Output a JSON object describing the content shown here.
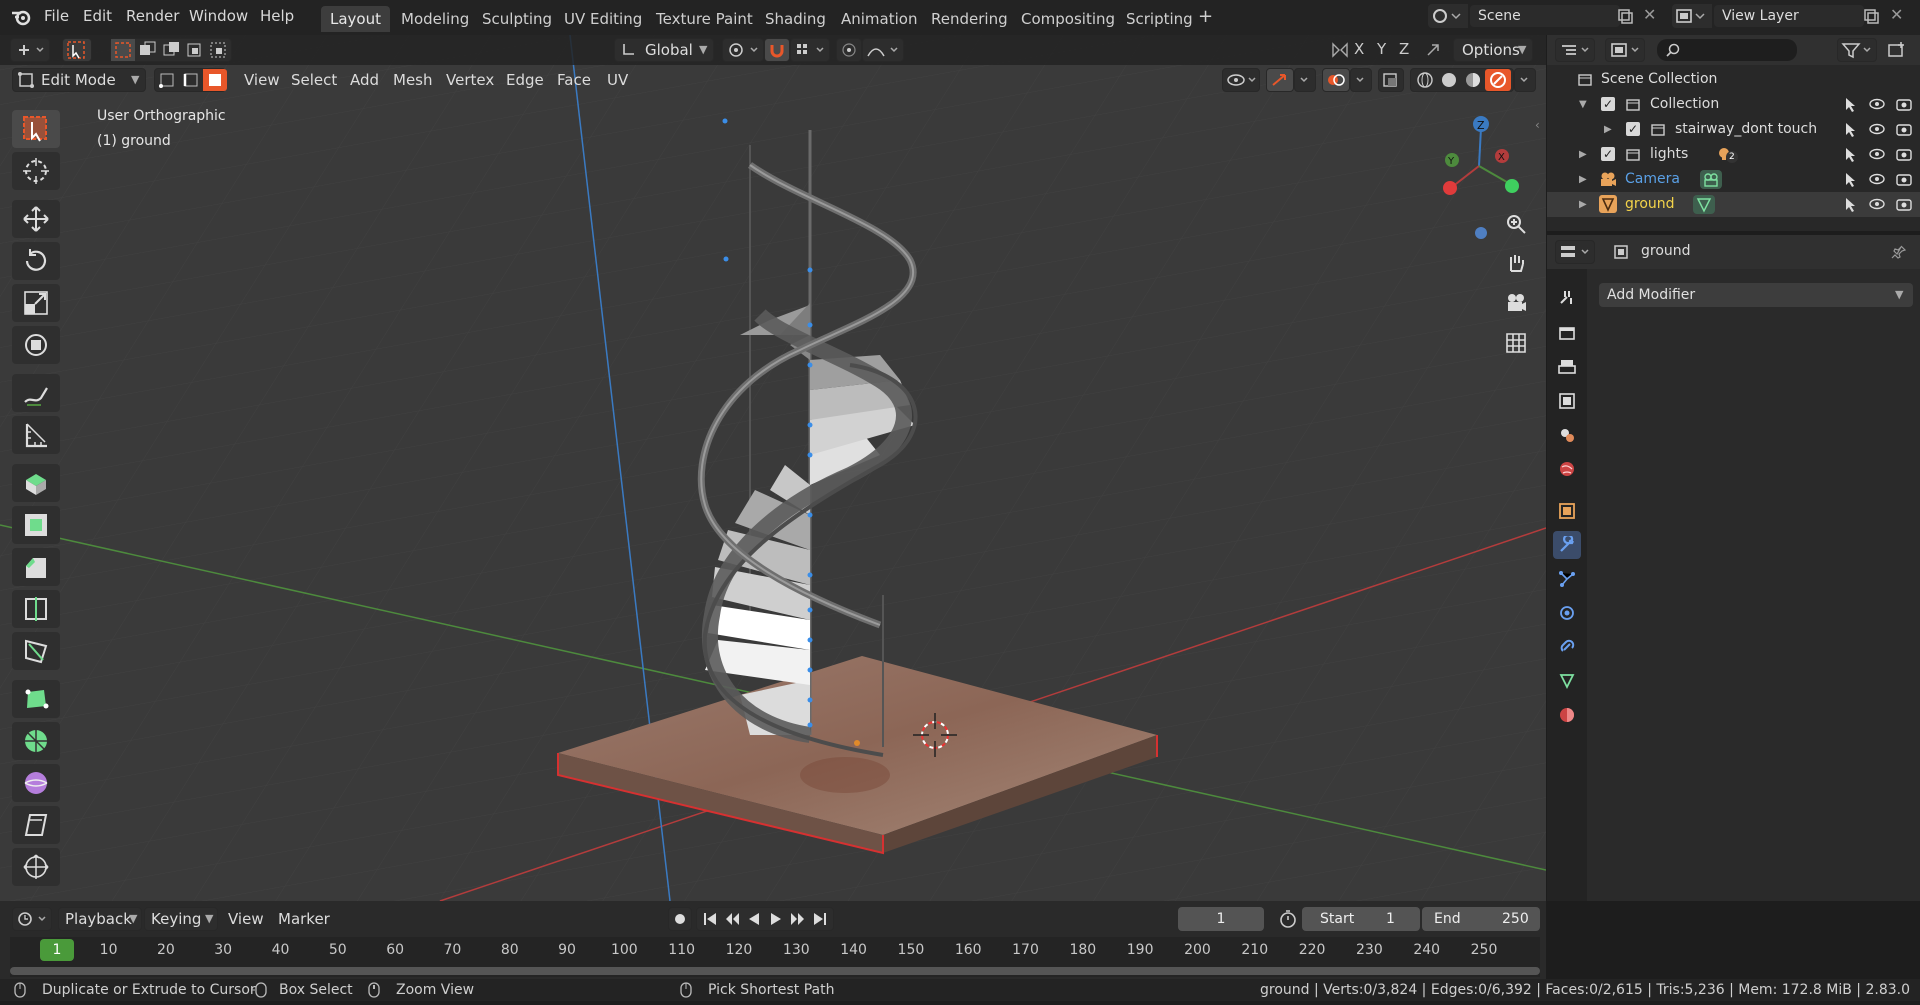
{
  "menu": {
    "file": "File",
    "edit": "Edit",
    "render": "Render",
    "window": "Window",
    "help": "Help"
  },
  "workspaces": [
    "Layout",
    "Modeling",
    "Sculpting",
    "UV Editing",
    "Texture Paint",
    "Shading",
    "Animation",
    "Rendering",
    "Compositing",
    "Scripting"
  ],
  "scene": {
    "scene_name": "Scene",
    "view_layer": "View Layer"
  },
  "viewport": {
    "mode": "Edit Mode",
    "menus": [
      "View",
      "Select",
      "Add",
      "Mesh",
      "Vertex",
      "Edge",
      "Face",
      "UV"
    ],
    "orientation": "Global",
    "options": "Options",
    "view_name": "User Orthographic",
    "object_label": "(1) ground",
    "axis_x": "X",
    "axis_y": "Y",
    "axis_z": "Z"
  },
  "outliner": {
    "root": "Scene Collection",
    "items": [
      {
        "label": "Collection"
      },
      {
        "label": "stairway_dont touch"
      },
      {
        "label": "lights",
        "badge": "2"
      },
      {
        "label": "Camera"
      },
      {
        "label": "ground"
      }
    ]
  },
  "properties": {
    "object_name": "ground",
    "add_modifier": "Add Modifier"
  },
  "timeline": {
    "menus": {
      "playback": "Playback",
      "keying": "Keying",
      "view": "View",
      "marker": "Marker"
    },
    "current_frame": "1",
    "start_label": "Start",
    "start": "1",
    "end_label": "End",
    "end": "250",
    "ticks": [
      "1",
      "10",
      "20",
      "30",
      "40",
      "50",
      "60",
      "70",
      "80",
      "90",
      "100",
      "110",
      "120",
      "130",
      "140",
      "150",
      "160",
      "170",
      "180",
      "190",
      "200",
      "210",
      "220",
      "230",
      "240",
      "250"
    ]
  },
  "status": {
    "hint1": "Duplicate or Extrude to Cursor",
    "hint2": "Box Select",
    "hint3": "Zoom View",
    "hint4": "Pick Shortest Path",
    "stats": "ground | Verts:0/3,824 | Edges:0/6,392 | Faces:0/2,615 | Tris:5,236 | Mem: 172.8 MiB | 2.83.0"
  },
  "colors": {
    "accent": "#e8572a",
    "blue_active": "#4772b3",
    "camera_text": "#5aa0e6",
    "ground_text": "#f3d34a",
    "grid_red": "#b33c3c",
    "grid_green": "#4d8a3d",
    "z_axis_blue": "#3a7ac2"
  }
}
